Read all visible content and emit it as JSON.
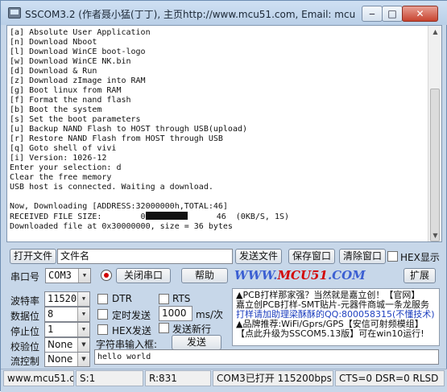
{
  "window": {
    "title": "SSCOM3.2 (作者聂小猛(丁丁), 主页http://www.mcu51.com,  Email: mcu..."
  },
  "titlebar_buttons": {
    "min": "‒",
    "max": "□",
    "close": "✕"
  },
  "terminal": {
    "lines_before": "[a] Absolute User Application\n[n] Download Nboot\n[l] Download WinCE boot-logo\n[w] Download WinCE NK.bin\n[d] Download & Run\n[z] Download zImage into RAM\n[g] Boot linux from RAM\n[f] Format the nand flash\n[b] Boot the system\n[s] Set the boot parameters\n[u] Backup NAND Flash to HOST through USB(upload)\n[r] Restore NAND Flash from HOST through USB\n[q] Goto shell of vivi\n[i] Version: 1026-12\nEnter your selection: d\nClear the free memory\nUSB host is connected. Waiting a download.\n\nNow, Downloading [ADDRESS:32000000h,TOTAL:46]\nRECEIVED FILE SIZE:        0",
    "lines_after": "      46  (0KB/S, 1S)\nDownloaded file at 0x30000000, size = 36 bytes"
  },
  "toolbar1": {
    "open_file": "打开文件",
    "file_name": "文件名",
    "send_file": "发送文件",
    "save_window": "保存窗口",
    "clear_window": "清除窗口",
    "hex_display": "HEX显示"
  },
  "toolbar2": {
    "port_label": "串口号",
    "port_value": "COM3",
    "close_port": "关闭串口",
    "help": "帮助",
    "website": "WWW.",
    "website_red": "MCU51",
    "website_end": ".COM",
    "expand": "扩展"
  },
  "settings": {
    "baud_label": "波特率",
    "baud_value": "115200",
    "databits_label": "数据位",
    "databits_value": "8",
    "stopbits_label": "停止位",
    "stopbits_value": "1",
    "parity_label": "校验位",
    "parity_value": "None",
    "flow_label": "流控制",
    "flow_value": "None",
    "dtr": "DTR",
    "rts": "RTS",
    "timed_send": "定时发送",
    "interval_value": "1000",
    "interval_unit": "ms/次",
    "hex_send": "HEX发送",
    "send_newline": "发送新行",
    "input_label": "字符串输入框:",
    "send": "发送",
    "input_value": "hello world"
  },
  "ad": {
    "line1": "▲PCB打样那家强？当然就是嘉立创！【官网】",
    "line2": "嘉立创PCB打样-SMT贴片-元器件商城一条龙服务",
    "line3": "打样请加助理梁酥酥的QQ:800058315(不懂技术)",
    "line4": "▲品牌推荐:WiFi/Gprs/GPS【安信可射频模组】",
    "line5": "【点此升级为SSCOM5.13版】可在win10运行!"
  },
  "status": {
    "site": "www.mcu51.cor",
    "sent": "S:1",
    "received": "R:831",
    "port_state": "COM3已打开  115200bps",
    "signals": "CTS=0 DSR=0 RLSD"
  }
}
